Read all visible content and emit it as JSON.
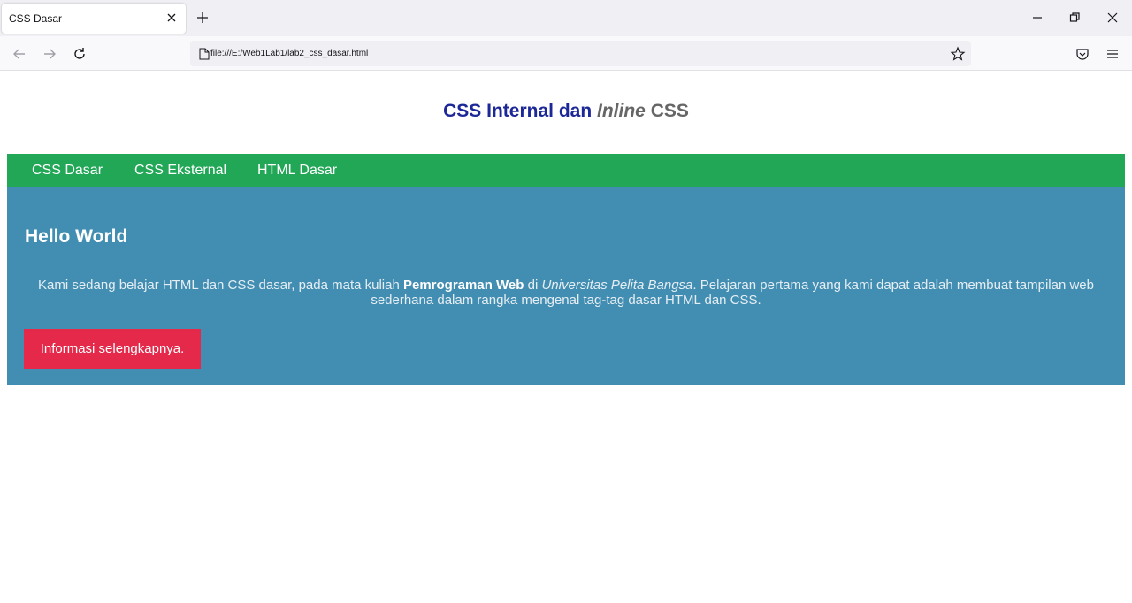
{
  "browser": {
    "tab_title": "CSS Dasar",
    "url": "file:///E:/Web1Lab1/lab2_css_dasar.html"
  },
  "page": {
    "title_main": "CSS Internal dan",
    "title_inline": "Inline",
    "title_css": "CSS",
    "menu": [
      {
        "label": "CSS Dasar"
      },
      {
        "label": "CSS Eksternal"
      },
      {
        "label": "HTML Dasar"
      }
    ],
    "hero": {
      "heading": "Hello World",
      "text_1": "Kami sedang belajar HTML dan CSS dasar, pada mata kuliah",
      "text_bold": "Pemrograman Web",
      "text_2": "di",
      "text_italic": "Universitas Pelita Bangsa",
      "text_3": ". Pelajaran pertama yang kami dapat adalah membuat tampilan web sederhana dalam rangka mengenal tag-tag dasar HTML dan CSS.",
      "button": "Informasi selengkapnya."
    }
  },
  "colors": {
    "title": "#1d2898",
    "menu_bg": "#22a757",
    "hero_bg": "#428eb2",
    "button_bg": "#e5294a"
  }
}
